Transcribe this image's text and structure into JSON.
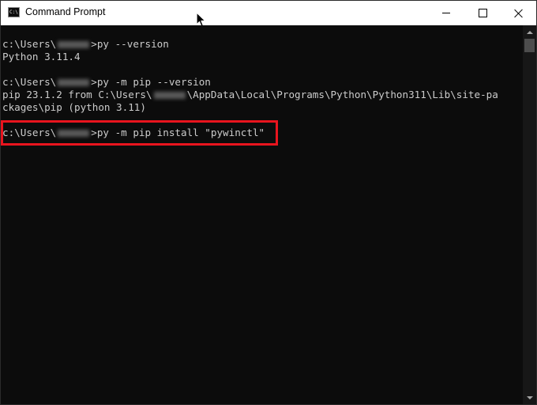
{
  "window": {
    "title": "Command Prompt",
    "icon": "cmd-icon",
    "icon_glyph": "C:\\"
  },
  "controls": {
    "minimize": "minimize-icon",
    "maximize": "maximize-icon",
    "close": "close-icon"
  },
  "console": {
    "lines": [
      {
        "prefix": "c:\\Users\\",
        "redacted": true,
        "suffix": ">py --version"
      },
      {
        "text": "Python 3.11.4"
      },
      {
        "text": ""
      },
      {
        "prefix": "c:\\Users\\",
        "redacted": true,
        "suffix": ">py -m pip --version"
      },
      {
        "prefix": "pip 23.1.2 from C:\\Users\\",
        "redacted": true,
        "suffix": "\\AppData\\Local\\Programs\\Python\\Python311\\Lib\\site-pa"
      },
      {
        "text": "ckages\\pip (python 3.11)"
      },
      {
        "text": ""
      },
      {
        "prefix": "c:\\Users\\",
        "redacted": true,
        "suffix": ">py -m pip install \"pywinctl\""
      }
    ],
    "highlighted_line_index": 7,
    "highlight_color": "#e8141e",
    "background_color": "#0c0c0c",
    "text_color": "#cccccc"
  }
}
